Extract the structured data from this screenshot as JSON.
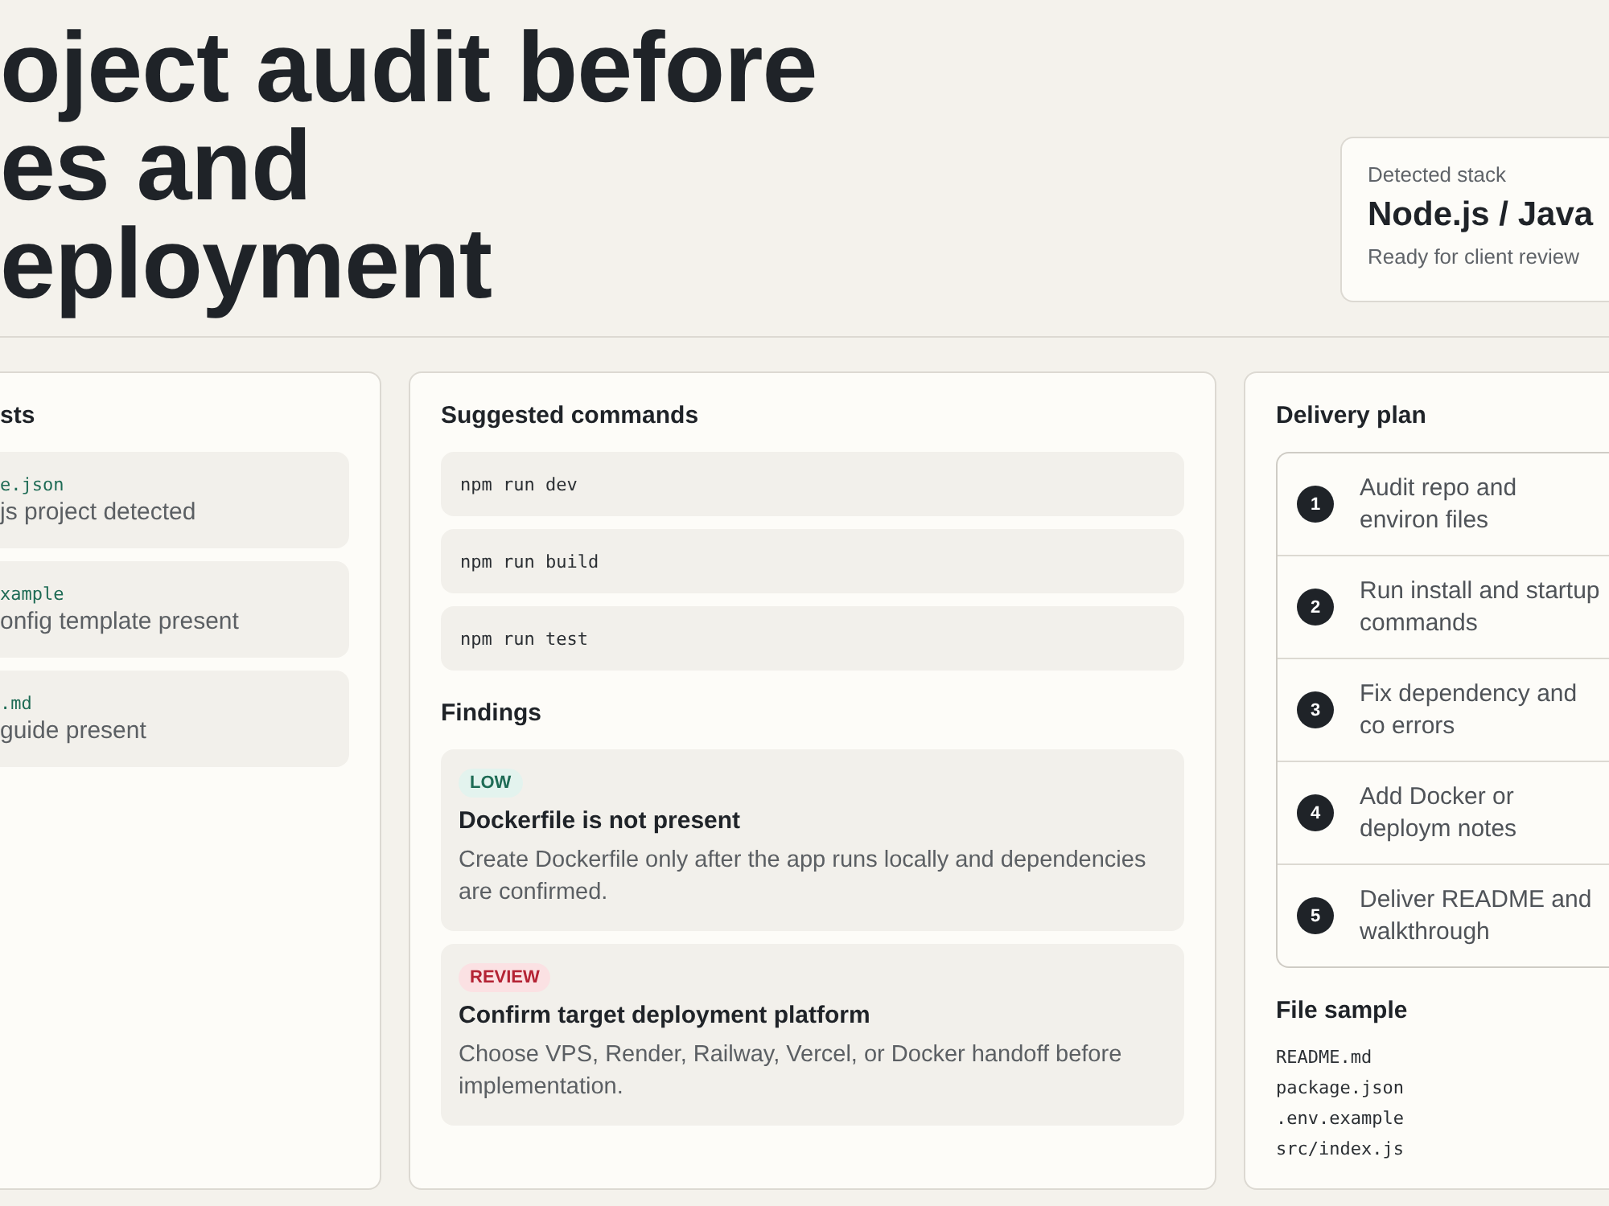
{
  "header": {
    "title_lines": [
      "oject audit before",
      "es and",
      "eployment"
    ],
    "stack": {
      "label": "Detected stack",
      "value": "Node.js / Java",
      "note": "Ready for client review"
    }
  },
  "artifacts": {
    "title": "sts",
    "items": [
      {
        "file": "e.json",
        "note": "js project detected"
      },
      {
        "file": "xample",
        "note": "onfig template present"
      },
      {
        "file": ".md",
        "note": "guide present"
      }
    ]
  },
  "commands": {
    "title": "Suggested commands",
    "items": [
      "npm run dev",
      "npm run build",
      "npm run test"
    ]
  },
  "findings": {
    "title": "Findings",
    "items": [
      {
        "badge": "LOW",
        "kind": "low",
        "title": "Dockerfile is not present",
        "text": "Create Dockerfile only after the app runs locally and dependencies are confirmed."
      },
      {
        "badge": "REVIEW",
        "kind": "review",
        "title": "Confirm target deployment platform",
        "text": "Choose VPS, Render, Railway, Vercel, or Docker handoff before implementation."
      }
    ]
  },
  "plan": {
    "title": "Delivery plan",
    "steps": [
      {
        "number": "1",
        "text": "Audit repo and environ files"
      },
      {
        "number": "2",
        "text": "Run install and startup commands"
      },
      {
        "number": "3",
        "text": "Fix dependency and co errors"
      },
      {
        "number": "4",
        "text": "Add Docker or deploym notes"
      },
      {
        "number": "5",
        "text": "Deliver README and walkthrough"
      }
    ]
  },
  "file_sample": {
    "title": "File sample",
    "files": [
      "README.md",
      "package.json",
      ".env.example",
      "src/index.js"
    ]
  }
}
